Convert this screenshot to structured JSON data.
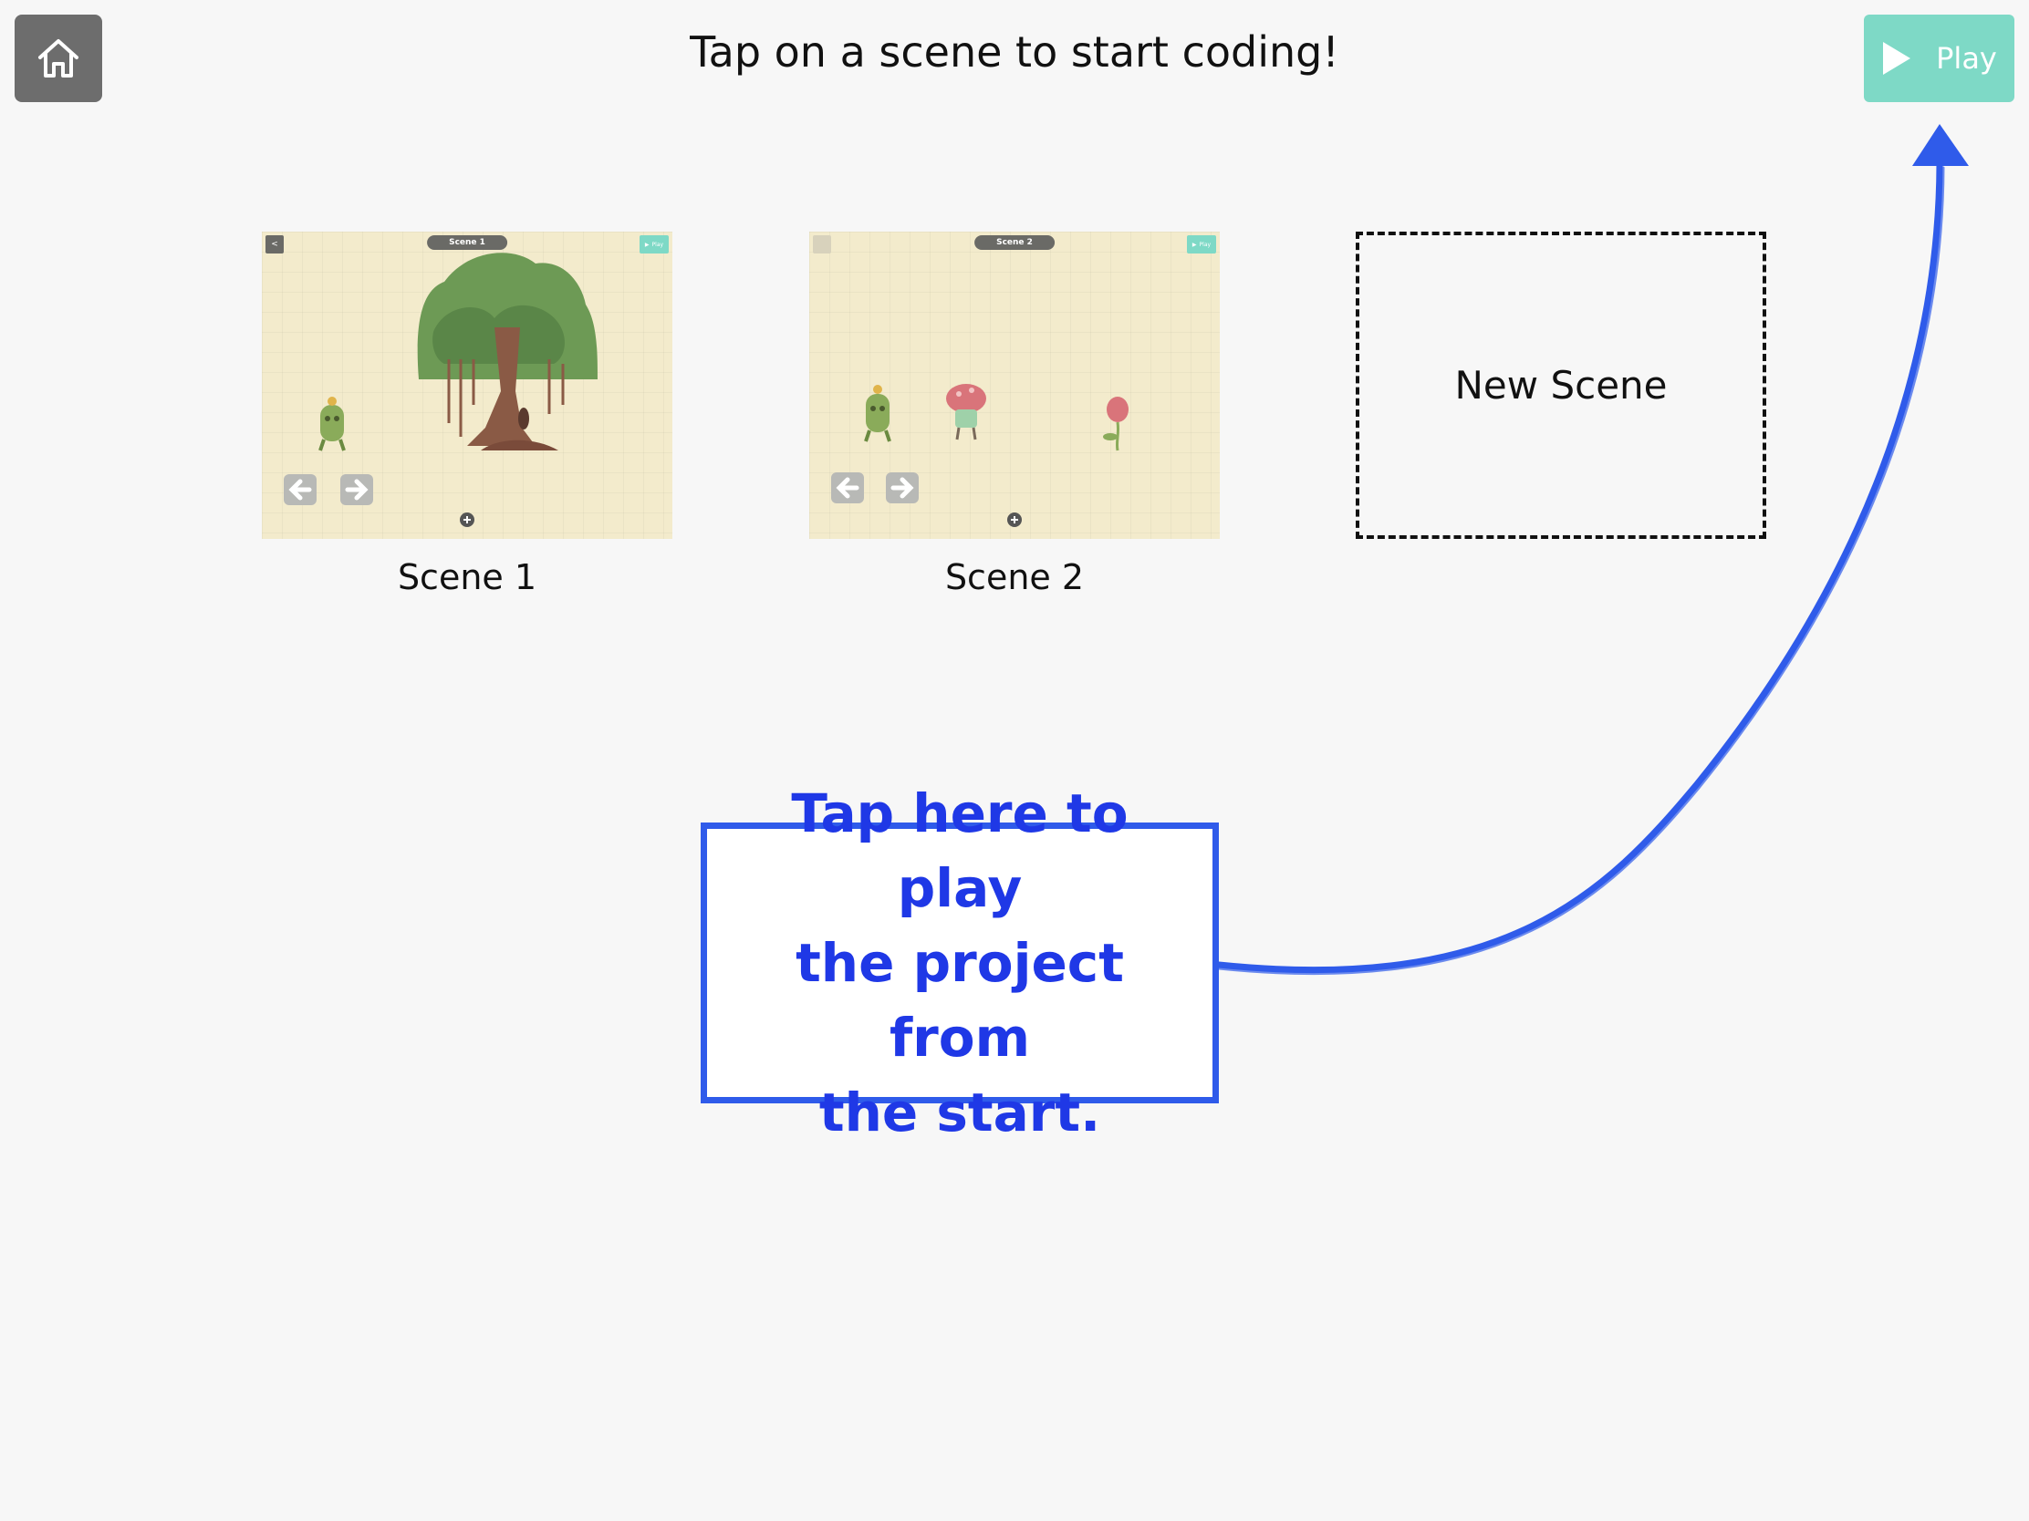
{
  "header": {
    "title": "Tap on a scene to start coding!",
    "home_icon": "home-icon",
    "play_label": "Play",
    "play_icon": "play-triangle-icon"
  },
  "scenes": [
    {
      "label": "Scene 1",
      "thumbnail": {
        "mini_title": "Scene 1",
        "mini_play": "Play",
        "mini_back": "<",
        "contents": [
          "banyan-tree",
          "green-monster-character",
          "left-arrow-button",
          "right-arrow-button",
          "add-icon"
        ]
      }
    },
    {
      "label": "Scene 2",
      "thumbnail": {
        "mini_title": "Scene 2",
        "mini_play": "Play",
        "contents": [
          "green-monster-character",
          "mushroom-character",
          "flower-character",
          "left-arrow-button",
          "right-arrow-button",
          "add-icon"
        ]
      }
    }
  ],
  "new_scene": {
    "label": "New Scene"
  },
  "callout": {
    "line1": "Tap here to play",
    "line2": "the project from",
    "line3": "the start."
  },
  "colors": {
    "background": "#f7f7f7",
    "play_button": "#7ed9c6",
    "home_button": "#6d6d6d",
    "callout_blue": "#2f5bea",
    "callout_text": "#1f38e6",
    "thumb_background": "#f3ebcc"
  }
}
